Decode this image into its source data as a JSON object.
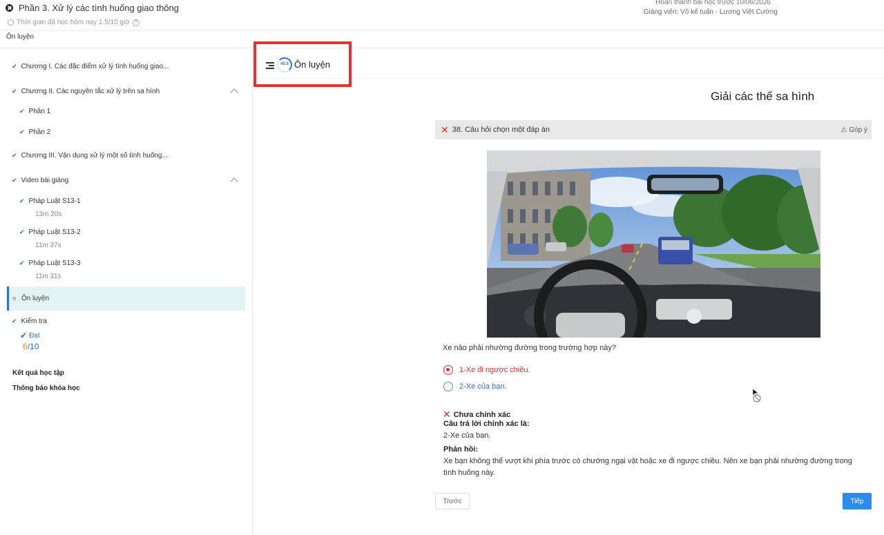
{
  "header": {
    "course_title": "Phần 3. Xử lý các tình huống giao thông",
    "study_time": "Thời gian đã học hôm nay 1.5/10 giờ",
    "deadline": "Hoàn thành bài học trước 10/06/2026",
    "teachers": "Giảng viên: Võ kế tuấn - Lương Việt Cường",
    "section": "Ôn luyện"
  },
  "sidebar": {
    "chapters": [
      {
        "label": "Chương I. Các đặc điểm xử lý tình huống giao..."
      },
      {
        "label": "Chương II. Các nguyên tắc xử lý trên sa hình"
      },
      {
        "label": "Chương III. Vận dụng xử lý một số tình huống..."
      }
    ],
    "parts": [
      {
        "label": "Phần 1"
      },
      {
        "label": "Phần 2"
      }
    ],
    "video_group": "Video bài giảng",
    "videos": [
      {
        "label": "Pháp Luật S13-1",
        "duration": "13m 20s"
      },
      {
        "label": "Pháp Luật S13-2",
        "duration": "11m 37s"
      },
      {
        "label": "Pháp Luật S13-3",
        "duration": "11m 31s"
      }
    ],
    "active": "Ôn luyện",
    "test": {
      "label": "Kiểm tra",
      "status": "Đạt",
      "score": "6",
      "total": "/10"
    },
    "results": "Kết quả học tập",
    "notices": "Thông báo khóa học"
  },
  "main_header": {
    "progress": "49.8",
    "title": "Ôn luyện"
  },
  "content": {
    "section_title": "Giải các thế sa hình",
    "question_header": "38. Câu hỏi chọn một đáp án",
    "feedback_link": "Góp ý",
    "question": "Xe nào phải nhường đường trong trường hợp này?",
    "options": [
      {
        "label": "1-Xe đi ngược chiều.",
        "selected": true
      },
      {
        "label": "2-Xe của bạn.",
        "selected": false
      }
    ],
    "verdict": "Chưa chính xác",
    "correct_label": "Câu trả lời chính xác là:",
    "correct_answer": "2-Xe của bạn.",
    "feedback_label": "Phản hồi:",
    "explanation": "Xe bạn không thể vượt khi phía trước có chướng ngại vật hoặc xe đi ngược chiều. Nên xe bạn phải nhường đường trong tình huống này.",
    "prev_label": "Trước",
    "next_label": "Tiếp"
  },
  "colors": {
    "accent": "#2a8cf0",
    "error": "#d9302e",
    "highlight_box": "#e53030"
  }
}
